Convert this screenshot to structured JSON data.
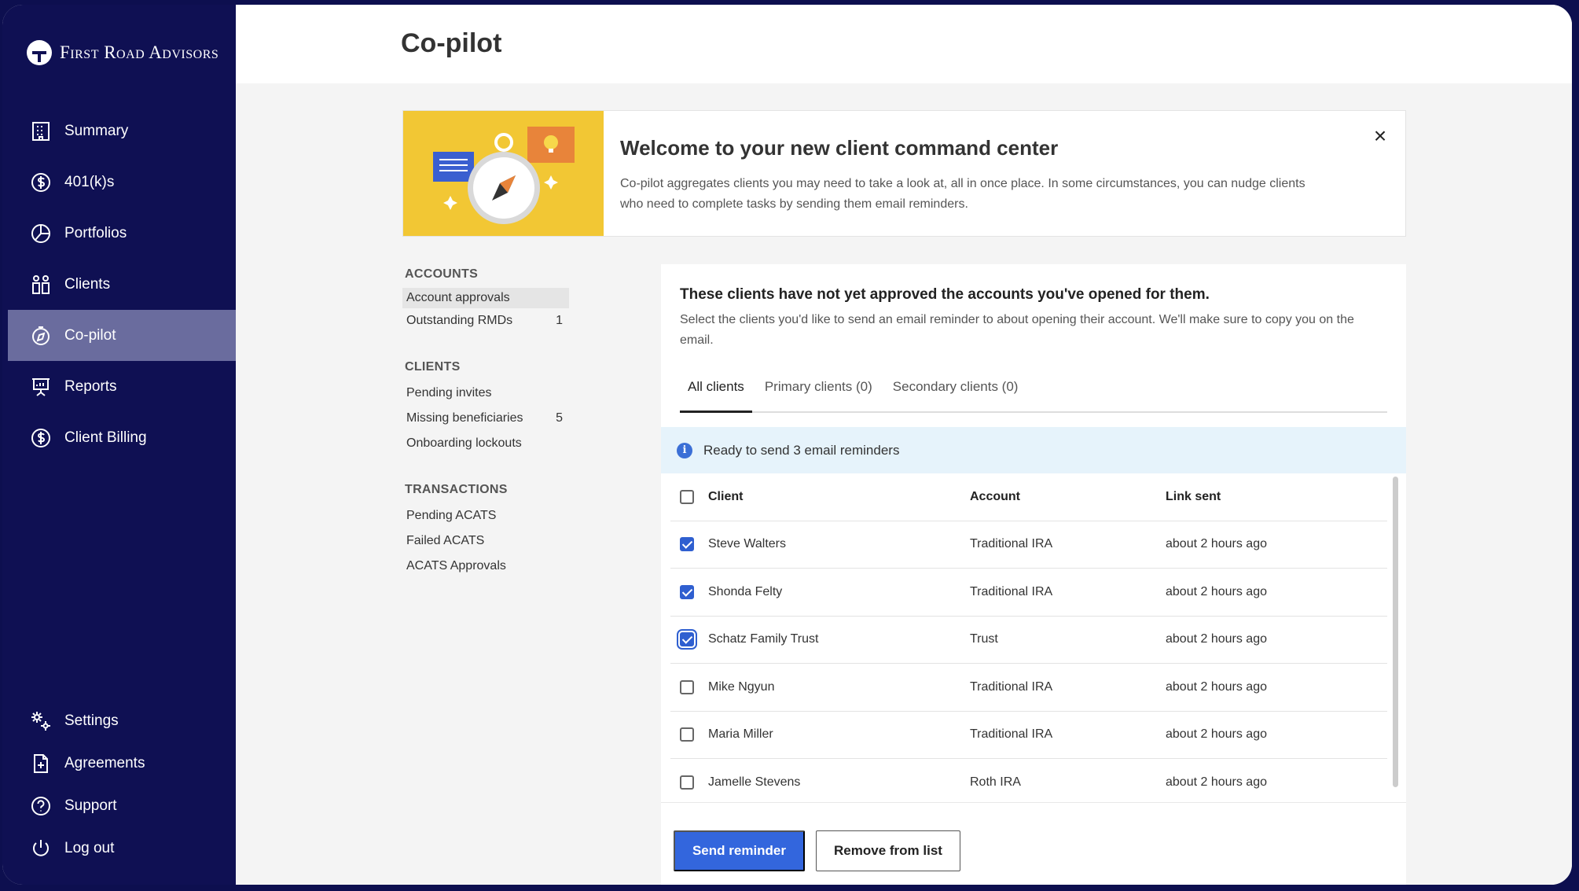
{
  "brand": {
    "name": "First Road Advisors"
  },
  "nav": {
    "items": [
      {
        "label": "Summary",
        "icon": "building-icon",
        "active": false
      },
      {
        "label": "401(k)s",
        "icon": "dollar-circle-icon",
        "active": false
      },
      {
        "label": "Portfolios",
        "icon": "pie-chart-icon",
        "active": false
      },
      {
        "label": "Clients",
        "icon": "people-icon",
        "active": false
      },
      {
        "label": "Co-pilot",
        "icon": "compass-icon",
        "active": true
      },
      {
        "label": "Reports",
        "icon": "presentation-icon",
        "active": false
      },
      {
        "label": "Client Billing",
        "icon": "dollar-circle-icon",
        "active": false
      }
    ],
    "bottom": [
      {
        "label": "Settings",
        "icon": "gears-icon"
      },
      {
        "label": "Agreements",
        "icon": "document-plus-icon"
      },
      {
        "label": "Support",
        "icon": "question-circle-icon"
      },
      {
        "label": "Log out",
        "icon": "power-icon"
      }
    ]
  },
  "page": {
    "title": "Co-pilot"
  },
  "banner": {
    "title": "Welcome to your new client command center",
    "text": "Co-pilot aggregates clients you may need to take a look at, all in once place. In some circumstances, you can nudge clients who need to complete tasks by sending them email reminders.",
    "close_label": "×"
  },
  "subnav": {
    "accounts": {
      "heading": "ACCOUNTS",
      "items": [
        {
          "label": "Account approvals",
          "count": "",
          "active": true
        },
        {
          "label": "Outstanding RMDs",
          "count": "1",
          "active": false
        }
      ]
    },
    "clients": {
      "heading": "CLIENTS",
      "items": [
        {
          "label": "Pending invites",
          "count": ""
        },
        {
          "label": "Missing beneficiaries",
          "count": "5"
        },
        {
          "label": "Onboarding lockouts",
          "count": ""
        }
      ]
    },
    "transactions": {
      "heading": "TRANSACTIONS",
      "items": [
        {
          "label": "Pending ACATS",
          "count": ""
        },
        {
          "label": "Failed ACATS",
          "count": ""
        },
        {
          "label": "ACATS Approvals",
          "count": ""
        }
      ]
    }
  },
  "panel": {
    "title": "These clients have not yet approved the accounts you've opened for them.",
    "description": "Select the clients you'd like to send an email reminder to about opening their account. We'll make sure to copy you on the email.",
    "tabs": [
      "All clients",
      "Primary clients (0)",
      "Secondary clients (0)"
    ],
    "info": "Ready to send 3 email reminders",
    "columns": {
      "client": "Client",
      "account": "Account",
      "link_sent": "Link sent"
    },
    "rows": [
      {
        "client": "Steve Walters",
        "account": "Traditional IRA",
        "link_sent": "about 2 hours ago",
        "checked": true
      },
      {
        "client": "Shonda Felty",
        "account": "Traditional IRA",
        "link_sent": "about 2 hours ago",
        "checked": true
      },
      {
        "client": "Schatz Family Trust",
        "account": "Trust",
        "link_sent": "about 2 hours ago",
        "checked": true
      },
      {
        "client": "Mike Ngyun",
        "account": "Traditional IRA",
        "link_sent": "about 2 hours ago",
        "checked": false
      },
      {
        "client": "Maria Miller",
        "account": "Traditional IRA",
        "link_sent": "about 2 hours ago",
        "checked": false
      },
      {
        "client": "Jamelle Stevens",
        "account": "Roth IRA",
        "link_sent": "about 2 hours ago",
        "checked": false
      }
    ],
    "send_label": "Send reminder",
    "remove_label": "Remove from list"
  },
  "colors": {
    "sidebar": "#0f1053",
    "active_nav": "#6a6c9e",
    "primary": "#3366dd",
    "info_bg": "#e6f3fb",
    "banner_art": "#f2c734"
  }
}
